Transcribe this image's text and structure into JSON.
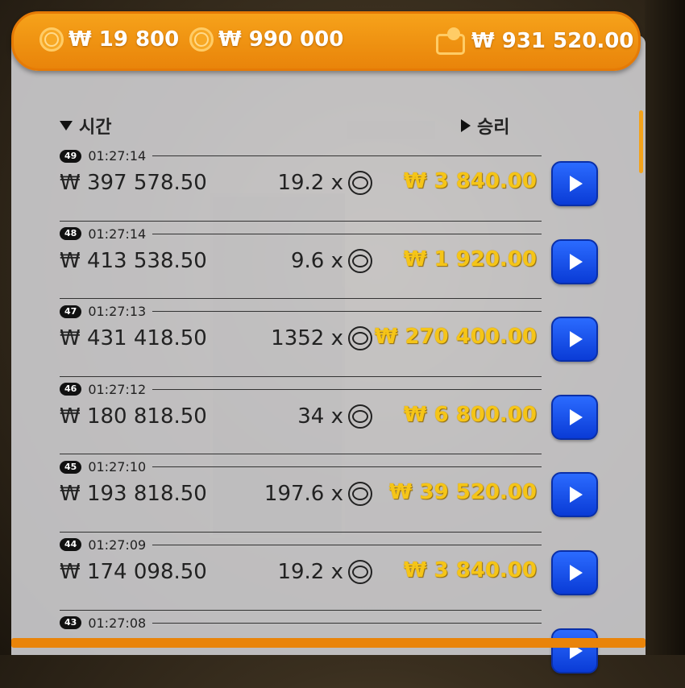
{
  "topbar": {
    "stake": "₩ 19 800",
    "max_win": "₩ 990 000",
    "balance": "₩ 931 520.00"
  },
  "headers": {
    "time": "시간",
    "win": "승리"
  },
  "rows": [
    {
      "round": "49",
      "time": "01:27:14",
      "bet": "₩ 397 578.50",
      "mult": "19.2 x",
      "win": "₩ 3 840.00"
    },
    {
      "round": "48",
      "time": "01:27:14",
      "bet": "₩ 413 538.50",
      "mult": "9.6 x",
      "win": "₩ 1 920.00"
    },
    {
      "round": "47",
      "time": "01:27:13",
      "bet": "₩ 431 418.50",
      "mult": "1352 x",
      "win": "₩ 270 400.00"
    },
    {
      "round": "46",
      "time": "01:27:12",
      "bet": "₩ 180 818.50",
      "mult": "34 x",
      "win": "₩ 6 800.00"
    },
    {
      "round": "45",
      "time": "01:27:10",
      "bet": "₩ 193 818.50",
      "mult": "197.6 x",
      "win": "₩ 39 520.00"
    },
    {
      "round": "44",
      "time": "01:27:09",
      "bet": "₩ 174 098.50",
      "mult": "19.2 x",
      "win": "₩ 3 840.00"
    },
    {
      "round": "43",
      "time": "01:27:08",
      "bet": "",
      "mult": "",
      "win": ""
    }
  ],
  "colors": {
    "accent": "#f5a623",
    "win_text": "#f5c518",
    "play_button": "#1f5cf2"
  }
}
